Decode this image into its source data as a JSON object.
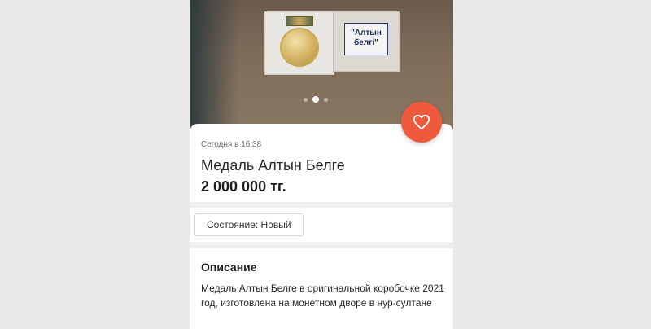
{
  "listing": {
    "posted": "Сегодня в 16:38",
    "title": "Медаль Алтын Белге",
    "price": "2 000 000 тг.",
    "favorite_icon": "heart-icon",
    "accent_color": "#f05a3c"
  },
  "photo": {
    "box_label": "\"Алтын белгі\"",
    "pager_total": 3,
    "pager_active": 2
  },
  "condition": {
    "chip": "Состояние: Новый"
  },
  "description": {
    "heading": "Описание",
    "text": "Медаль Алтын Белге в оригинальной коробочке 2021 год, изготовлена на монетном дворе в нур-султане"
  }
}
